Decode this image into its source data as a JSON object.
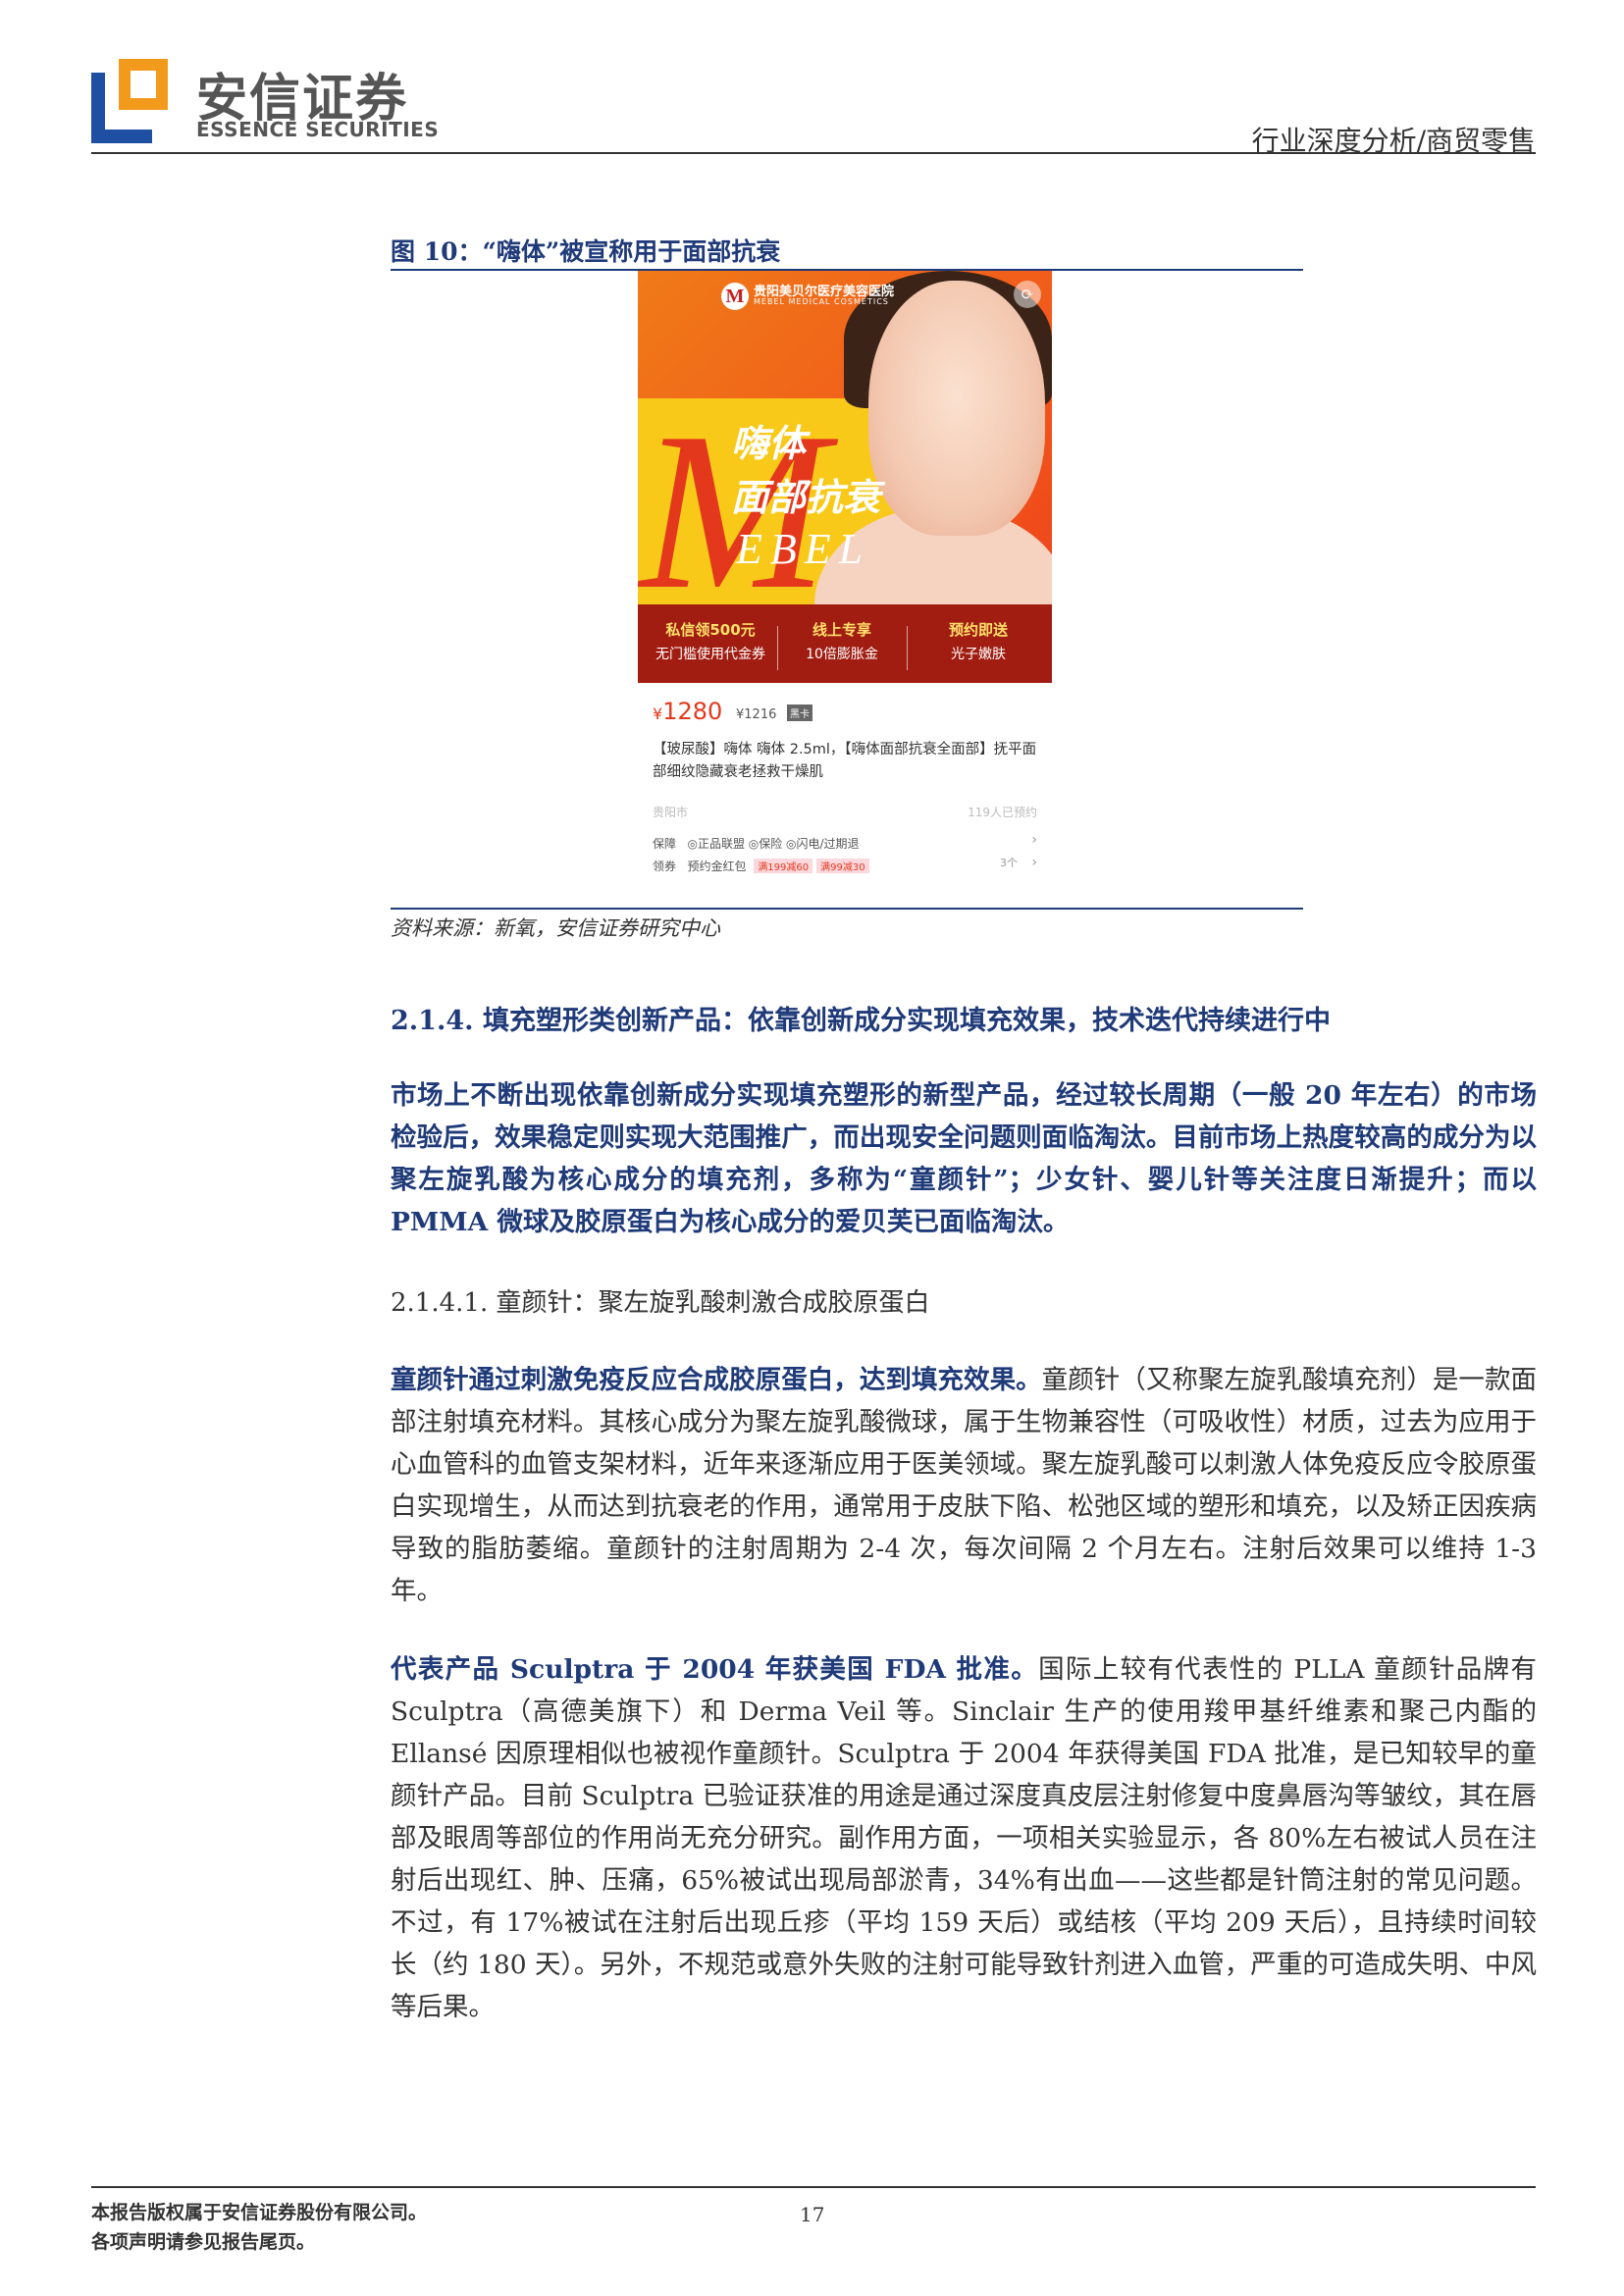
{
  "header": {
    "company_cn": "安信证券",
    "company_en": "ESSENCE SECURITIES",
    "report_type": "行业深度分析/商贸零售",
    "logo_colors": {
      "blue": "#1e4fa3",
      "orange": "#f29a1c"
    }
  },
  "figure": {
    "title": "图 10：“嗨体”被宣称用于面部抗衰",
    "source": "资料来源：新氧，安信证券研究中心",
    "ad": {
      "clinic_name": "贵阳美贝尔医疗美容医院",
      "clinic_en": "MEBEL MEDICAL COSMETICS",
      "clinic_logo": "M",
      "big_letter": "M",
      "heading_line1": "嗨体",
      "heading_line2": "面部抗衰",
      "brand_text": "EBEL",
      "promos": [
        {
          "title": "私信领500元",
          "sub": "无门槛使用代金券"
        },
        {
          "title": "线上专享",
          "sub": "10倍膨胀金"
        },
        {
          "title": "预约即送",
          "sub": "光子嫩肤"
        }
      ],
      "price_symbol": "¥",
      "price": "1280",
      "old_price": "¥1216",
      "price_tag": "黑卡",
      "description": "【玻尿酸】嗨体 嗨体 2.5ml，【嗨体面部抗衰全面部】抚平面部细纹隐藏衰老拯救干燥肌",
      "city": "贵阳市",
      "booked": "119人已预约",
      "guarantee_label": "保障",
      "guarantee_items": "◎正品联盟 ◎保险 ◎闪电/过期退",
      "coupon_label": "领券",
      "coupon_text": "预约金红包",
      "coupon_tags": [
        "满199减60",
        "满99减30"
      ],
      "coupon_count": "3个",
      "accent": "#e4381c"
    }
  },
  "sections": {
    "heading_214": "2.1.4. 填充塑形类创新产品：依靠创新成分实现填充效果，技术迭代持续进行中",
    "summary": "市场上不断出现依靠创新成分实现填充塑形的新型产品，经过较长周期（一般 20 年左右）的市场检验后，效果稳定则实现大范围推广，而出现安全问题则面临淘汰。目前市场上热度较高的成分为以聚左旋乳酸为核心成分的填充剂，多称为“童颜针”；少女针、婴儿针等关注度日渐提升；而以 PMMA 微球及胶原蛋白为核心成分的爱贝芙已面临淘汰。",
    "heading_2141": "2.1.4.1. 童颜针：聚左旋乳酸刺激合成胶原蛋白",
    "para1_lead": "童颜针通过刺激免疫反应合成胶原蛋白，达到填充效果。",
    "para1_body": "童颜针（又称聚左旋乳酸填充剂）是一款面部注射填充材料。其核心成分为聚左旋乳酸微球，属于生物兼容性（可吸收性）材质，过去为应用于心血管科的血管支架材料，近年来逐渐应用于医美领域。聚左旋乳酸可以刺激人体免疫反应令胶原蛋白实现增生，从而达到抗衰老的作用，通常用于皮肤下陷、松弛区域的塑形和填充，以及矫正因疾病导致的脂肪萎缩。童颜针的注射周期为 2-4 次，每次间隔 2 个月左右。注射后效果可以维持 1-3 年。",
    "para2_lead": "代表产品 Sculptra 于 2004 年获美国 FDA 批准。",
    "para2_body": "国际上较有代表性的 PLLA 童颜针品牌有 Sculptra（高德美旗下）和 Derma Veil 等。Sinclair 生产的使用羧甲基纤维素和聚己内酯的 Ellansé 因原理相似也被视作童颜针。Sculptra 于 2004 年获得美国 FDA 批准，是已知较早的童颜针产品。目前 Sculptra 已验证获准的用途是通过深度真皮层注射修复中度鼻唇沟等皱纹，其在唇部及眼周等部位的作用尚无充分研究。副作用方面，一项相关实验显示，各 80%左右被试人员在注射后出现红、肿、压痛，65%被试出现局部淤青，34%有出血——这些都是针筒注射的常见问题。不过，有 17%被试在注射后出现丘疹（平均 159 天后）或结核（平均 209 天后），且持续时间较长（约 180 天）。另外，不规范或意外失败的注射可能导致针剂进入血管，严重的可造成失明、中风等后果。"
  },
  "footer": {
    "copyright": "本报告版权属于安信证券股份有限公司。",
    "disclaimer": "各项声明请参见报告尾页。",
    "page_number": "17"
  }
}
